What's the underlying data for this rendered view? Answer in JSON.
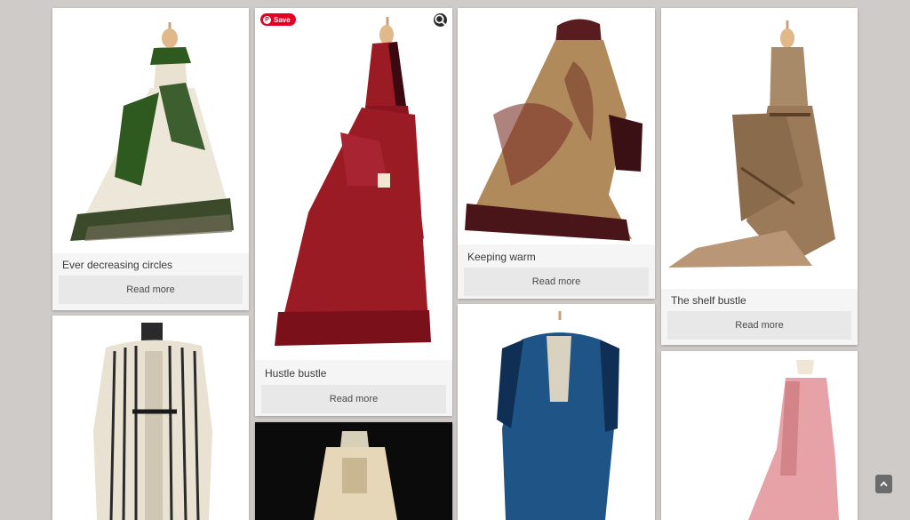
{
  "cards": [
    {
      "id": "ever-decreasing-circles",
      "title": "Ever decreasing circles",
      "button_label": "Read more",
      "dress_color": "#ece7d8",
      "accent_color": "#2f5a1f"
    },
    {
      "id": "hustle-bustle",
      "title": "Hustle bustle",
      "button_label": "Read more",
      "dress_color": "#9b1b25",
      "accent_color": "#3b0a10"
    },
    {
      "id": "keeping-warm",
      "title": "Keeping warm",
      "button_label": "Read more",
      "dress_color": "#b08a5a",
      "accent_color": "#5a1d1f"
    },
    {
      "id": "the-shelf-bustle",
      "title": "The shelf bustle",
      "button_label": "Read more",
      "dress_color": "#a98a68",
      "accent_color": "#5c4128"
    },
    {
      "id": "striped-dress",
      "dress_color": "#e9e2d2",
      "accent_color": "#2a2a2a"
    },
    {
      "id": "cream-lace-dress",
      "dress_color": "#e6d7b8",
      "accent_color": "#0b0b0b"
    },
    {
      "id": "blue-moire-dress",
      "dress_color": "#1f5487",
      "accent_color": "#0f2f55"
    },
    {
      "id": "pink-dress",
      "dress_color": "#e6a2a6",
      "accent_color": "#c9787e"
    }
  ],
  "pin_save": {
    "label": "Save",
    "color": "#e60023"
  },
  "icons": {
    "visual_search": "lens-icon",
    "scroll_top": "chevron-up-icon"
  }
}
